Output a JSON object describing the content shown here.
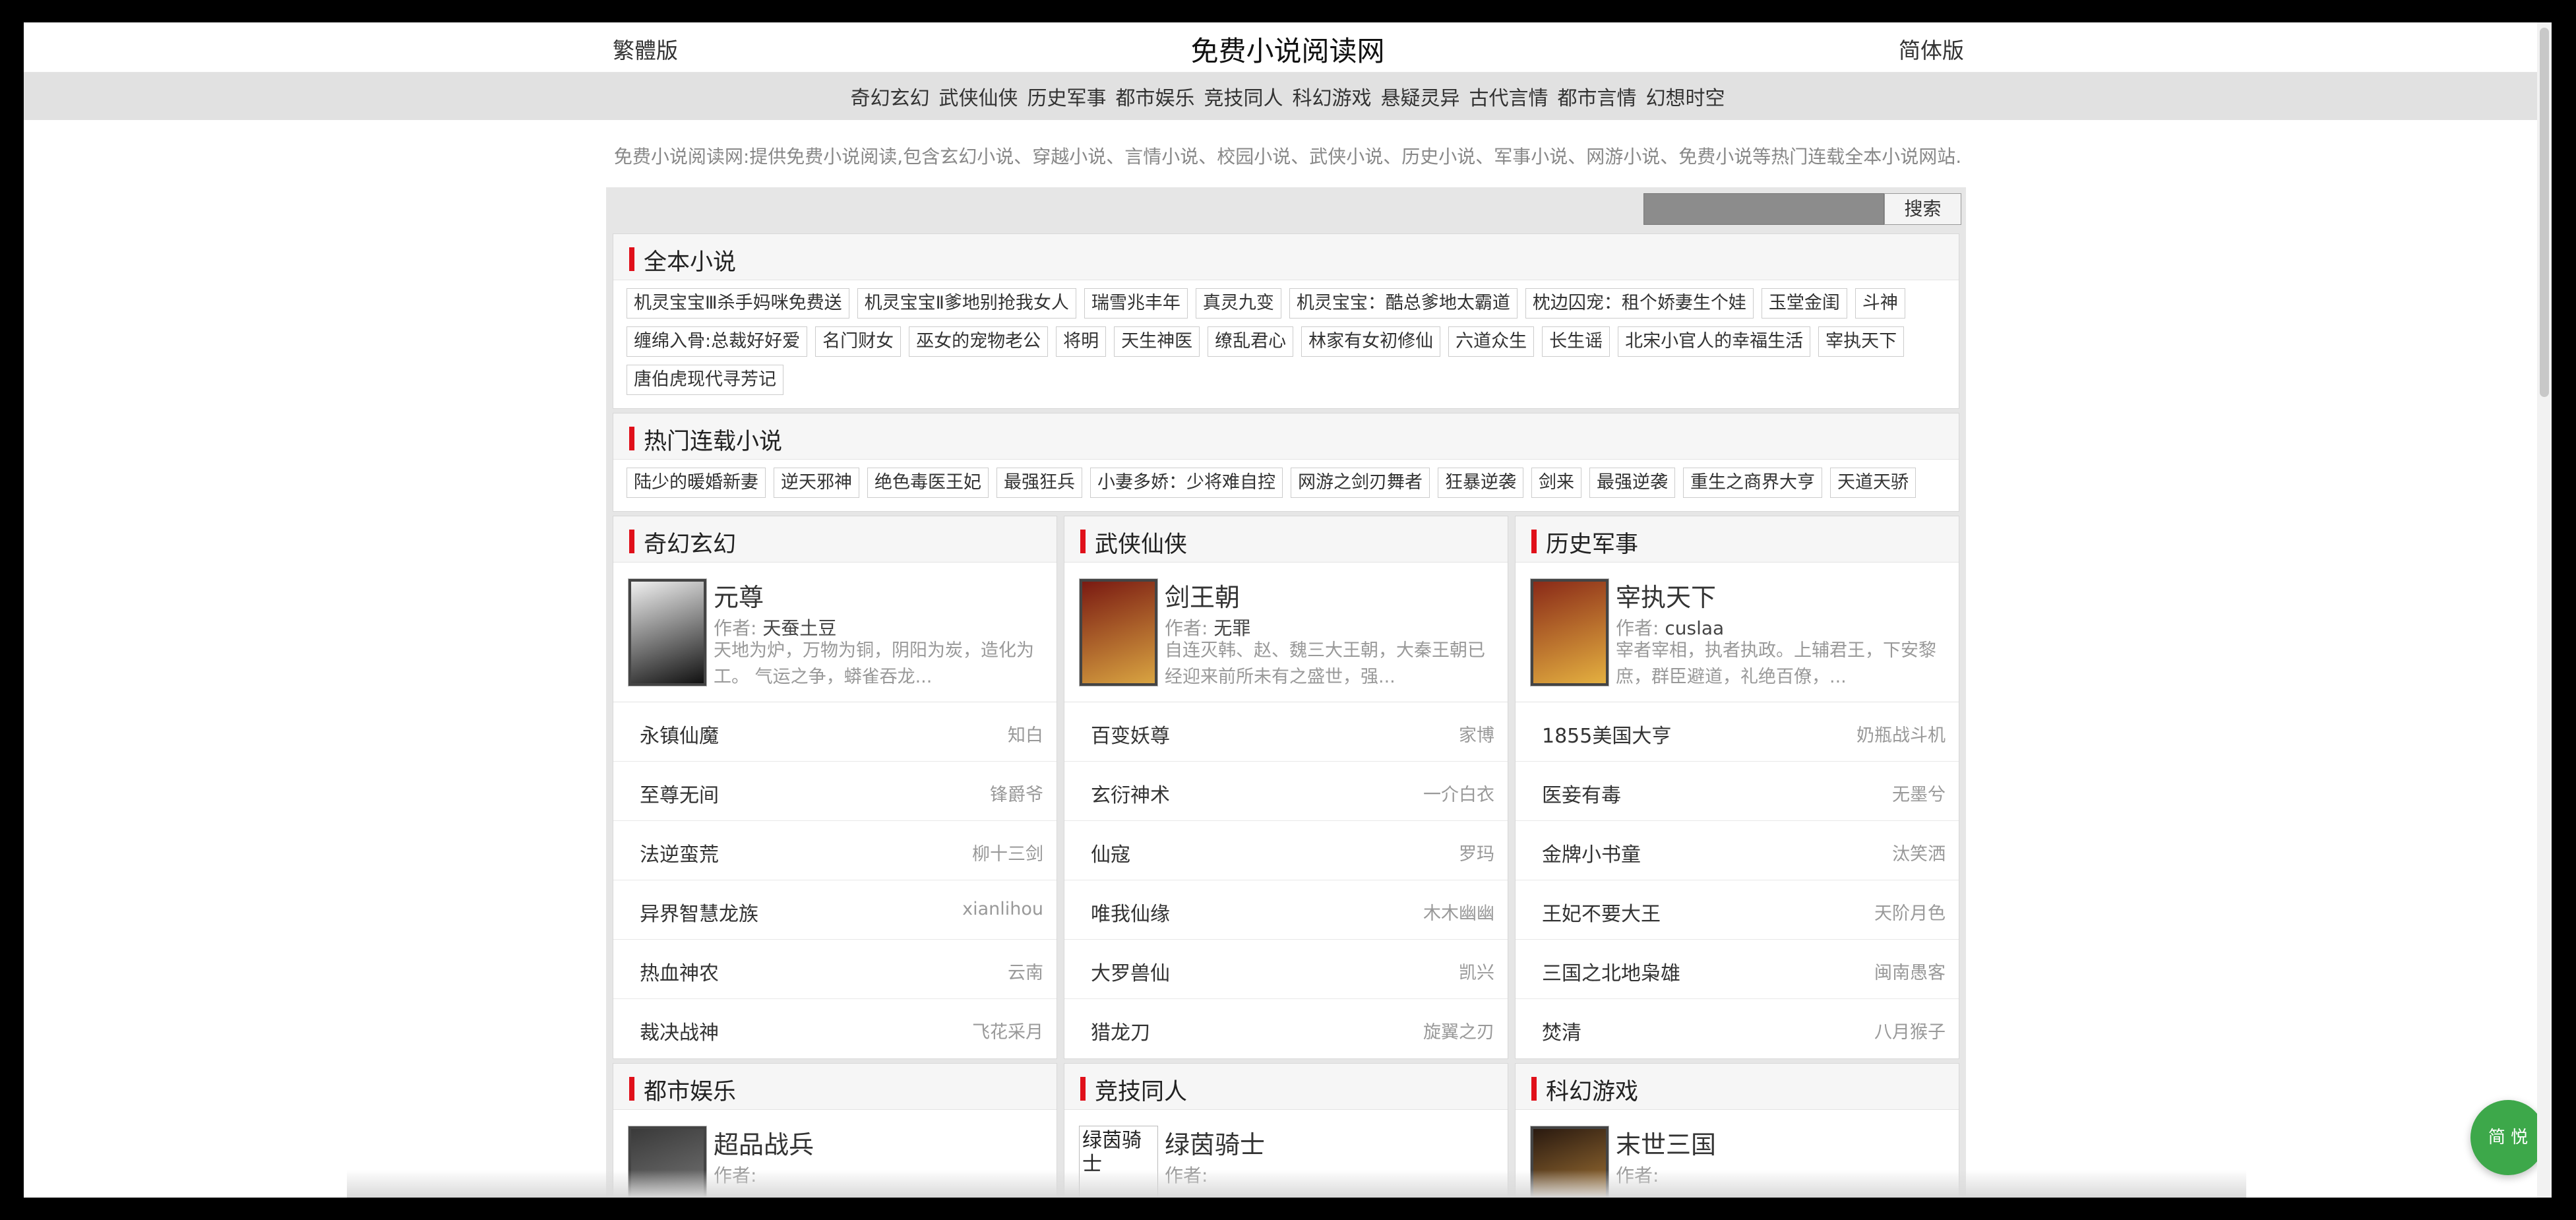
{
  "header": {
    "traditional": "繁體版",
    "site_title": "免费小说阅读网",
    "simplified": "简体版"
  },
  "nav": [
    "奇幻玄幻",
    "武侠仙侠",
    "历史军事",
    "都市娱乐",
    "竞技同人",
    "科幻游戏",
    "悬疑灵异",
    "古代言情",
    "都市言情",
    "幻想时空"
  ],
  "intro": "免费小说阅读网:提供免费小说阅读,包含玄幻小说、穿越小说、言情小说、校园小说、武侠小说、历史小说、军事小说、网游小说、免费小说等热门连载全本小说网站.",
  "search": {
    "button": "搜索",
    "value": ""
  },
  "complete": {
    "title": "全本小说",
    "tags": [
      "机灵宝宝Ⅲ杀手妈咪免费送",
      "机灵宝宝Ⅱ爹地别抢我女人",
      "瑞雪兆丰年",
      "真灵九变",
      "机灵宝宝：酷总爹地太霸道",
      "枕边囚宠：租个娇妻生个娃",
      "玉堂金闺",
      "斗神",
      "缠绵入骨:总裁好好爱",
      "名门财女",
      "巫女的宠物老公",
      "将明",
      "天生神医",
      "缭乱君心",
      "林家有女初修仙",
      "六道众生",
      "长生谣",
      "北宋小官人的幸福生活",
      "宰执天下",
      "唐伯虎现代寻芳记"
    ]
  },
  "serial": {
    "title": "热门连载小说",
    "tags": [
      "陆少的暖婚新妻",
      "逆天邪神",
      "绝色毒医王妃",
      "最强狂兵",
      "小妻多娇：少将难自控",
      "网游之剑刃舞者",
      "狂暴逆袭",
      "剑来",
      "最强逆袭",
      "重生之商界大亨",
      "天道天骄"
    ]
  },
  "author_label": "作者: ",
  "categories": [
    {
      "title": "奇幻玄幻",
      "feature": {
        "name": "元尊",
        "author": "天蚕土豆",
        "desc": "天地为炉，万物为铜，阴阳为炭，造化为工。 气运之争，蟒雀吞龙..."
      },
      "rows": [
        [
          "永镇仙魔",
          "知白"
        ],
        [
          "至尊无间",
          "锋爵爷"
        ],
        [
          "法逆蛮荒",
          "柳十三剑"
        ],
        [
          "异界智慧龙族",
          "xianlihou"
        ],
        [
          "热血神农",
          "云南"
        ],
        [
          "裁决战神",
          "飞花采月"
        ]
      ]
    },
    {
      "title": "武侠仙侠",
      "feature": {
        "name": "剑王朝",
        "author": "无罪",
        "desc": "自连灭韩、赵、魏三大王朝，大秦王朝已经迎来前所未有之盛世，强..."
      },
      "rows": [
        [
          "百变妖尊",
          "家博"
        ],
        [
          "玄衍神术",
          "一介白衣"
        ],
        [
          "仙寇",
          "罗玛"
        ],
        [
          "唯我仙缘",
          "木木幽幽"
        ],
        [
          "大罗兽仙",
          "凯兴"
        ],
        [
          "猎龙刀",
          "旋翼之刃"
        ]
      ]
    },
    {
      "title": "历史军事",
      "feature": {
        "name": "宰执天下",
        "author": "cuslaa",
        "desc": "宰者宰相，执者执政。上辅君王，下安黎庶，群臣避道，礼绝百僚，..."
      },
      "rows": [
        [
          "1855美国大亨",
          "奶瓶战斗机"
        ],
        [
          "医妾有毒",
          "无墨兮"
        ],
        [
          "金牌小书童",
          "汰笑洒"
        ],
        [
          "王妃不要大王",
          "天阶月色"
        ],
        [
          "三国之北地枭雄",
          "闽南愚客"
        ],
        [
          "焚清",
          "八月猴子"
        ]
      ]
    },
    {
      "title": "都市娱乐",
      "feature": {
        "name": "超品战兵",
        "author": "",
        "desc": ""
      },
      "rows": []
    },
    {
      "title": "竞技同人",
      "feature": {
        "name": "绿茵骑士",
        "author": "",
        "desc": "",
        "cover_alt": "绿茵骑士"
      },
      "rows": []
    },
    {
      "title": "科幻游戏",
      "feature": {
        "name": "末世三国",
        "author": "",
        "desc": ""
      },
      "rows": []
    }
  ],
  "lang_toggle": "简 悦",
  "colors": {
    "accent_bar": "#e0101a",
    "toggle": "#3da84a"
  }
}
